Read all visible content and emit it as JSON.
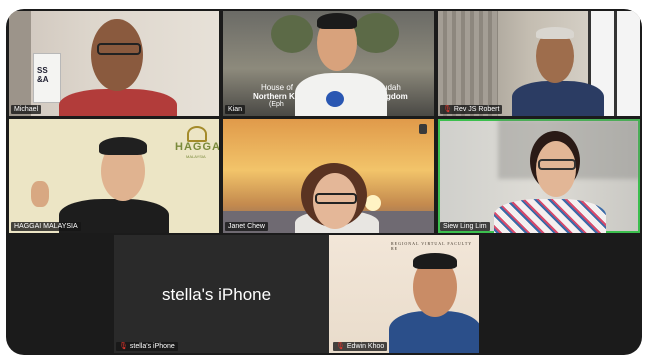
{
  "participants": {
    "michael": {
      "name": "Michael",
      "sign_text": "SS\n&A"
    },
    "kian": {
      "name": "Kian",
      "bg_text_line1": "House of",
      "bg_text_line1b": "udah",
      "bg_text_line2": "Northern K",
      "bg_text_line2b": "gdom",
      "bg_text_line3": "(Eph"
    },
    "robert": {
      "name": "Rev JS Robert"
    },
    "haggai": {
      "name": "HAGGAI MALAYSIA",
      "logo_text": "HAGGAI",
      "logo_sub": "MALAYSIA"
    },
    "janet": {
      "name": "Janet Chew"
    },
    "siew": {
      "name": "Siew Ling Lim"
    },
    "stella": {
      "name": "stella's iPhone",
      "display_name": "stella's iPhone"
    },
    "edwin": {
      "name": "Edwin Khoo",
      "banner_text": "REGIONAL VIRTUAL FACULTY RE"
    }
  },
  "colors": {
    "active_speaker": "#3cbf4e",
    "muted_mic": "#e2352c"
  }
}
